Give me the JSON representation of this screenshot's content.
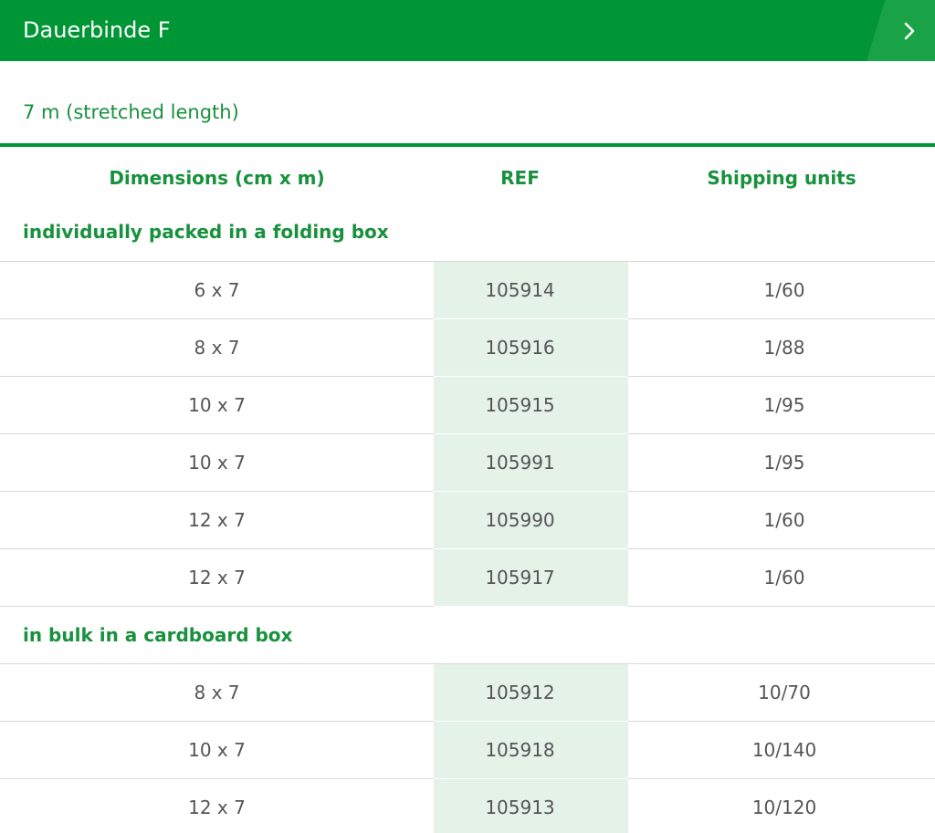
{
  "header": {
    "title": "Dauerbinde F",
    "chevron_icon": "chevron-right-icon",
    "background_color": "#009636"
  },
  "subtitle": "7 m (stretched length)",
  "table": {
    "columns": [
      "Dimensions (cm x m)",
      "REF",
      "Shipping units"
    ],
    "groups": [
      {
        "label": "individually packed in a folding box",
        "rows": [
          {
            "dimensions": "6 x 7",
            "ref": "105914",
            "shipping": "1/60"
          },
          {
            "dimensions": "8 x 7",
            "ref": "105916",
            "shipping": "1/88"
          },
          {
            "dimensions": "10 x 7",
            "ref": "105915",
            "shipping": "1/95"
          },
          {
            "dimensions": "10 x 7",
            "ref": "105991",
            "shipping": "1/95"
          },
          {
            "dimensions": "12 x 7",
            "ref": "105990",
            "shipping": "1/60"
          },
          {
            "dimensions": "12 x 7",
            "ref": "105917",
            "shipping": "1/60"
          }
        ]
      },
      {
        "label": "in bulk in a cardboard box",
        "rows": [
          {
            "dimensions": "8 x 7",
            "ref": "105912",
            "shipping": "10/70"
          },
          {
            "dimensions": "10 x 7",
            "ref": "105918",
            "shipping": "10/140"
          },
          {
            "dimensions": "12 x 7",
            "ref": "105913",
            "shipping": "10/120"
          }
        ]
      }
    ]
  },
  "colors": {
    "accent": "#009636",
    "text_green": "#18913d",
    "ref_highlight": "#e4f2e8",
    "body_text": "#555555"
  }
}
